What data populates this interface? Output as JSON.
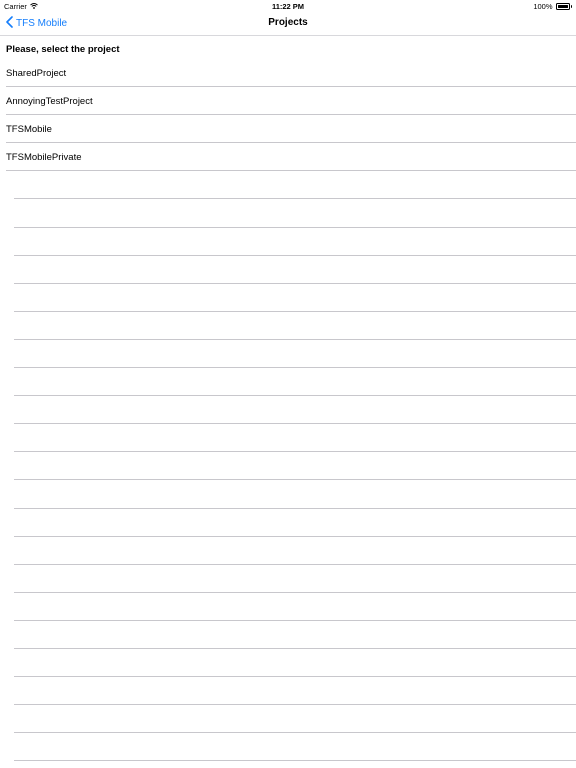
{
  "status_bar": {
    "carrier": "Carrier",
    "wifi_icon": "wifi-icon",
    "time": "11:22 PM",
    "battery_percent": "100%",
    "battery_level": 1.0
  },
  "nav_bar": {
    "back_label": "TFS Mobile",
    "back_icon": "chevron-left-icon",
    "title": "Projects"
  },
  "prompt": "Please, select the project",
  "projects": [
    "SharedProject",
    "AnnoyingTestProject",
    "TFSMobile",
    "TFSMobilePrivate"
  ],
  "colors": {
    "accent": "#157efb",
    "separator": "#c8c7cc"
  }
}
